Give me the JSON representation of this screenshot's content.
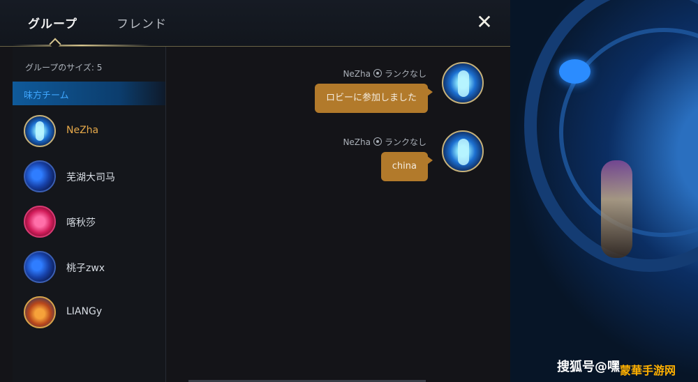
{
  "tabs": {
    "group": "グループ",
    "friend": "フレンド"
  },
  "close_label": "✕",
  "members_panel": {
    "group_size": "グループのサイズ: 5",
    "team_header": "味方チーム",
    "members": [
      {
        "name": "NeZha"
      },
      {
        "name": "芜湖大司马"
      },
      {
        "name": "喀秋莎"
      },
      {
        "name": "桃子zwx"
      },
      {
        "name": "LIANGy"
      }
    ]
  },
  "chat": {
    "messages": [
      {
        "sender": "NeZha",
        "rank": "ランクなし",
        "text": "ロビーに参加しました"
      },
      {
        "sender": "NeZha",
        "rank": "ランクなし",
        "text": "china"
      }
    ]
  },
  "watermark": {
    "left": "搜狐号@嘿",
    "right": "蒙華手游网"
  },
  "colors": {
    "bubble": "#b27a2b",
    "accent_blue": "#3fa7ff",
    "self_name": "#e7a94a"
  }
}
